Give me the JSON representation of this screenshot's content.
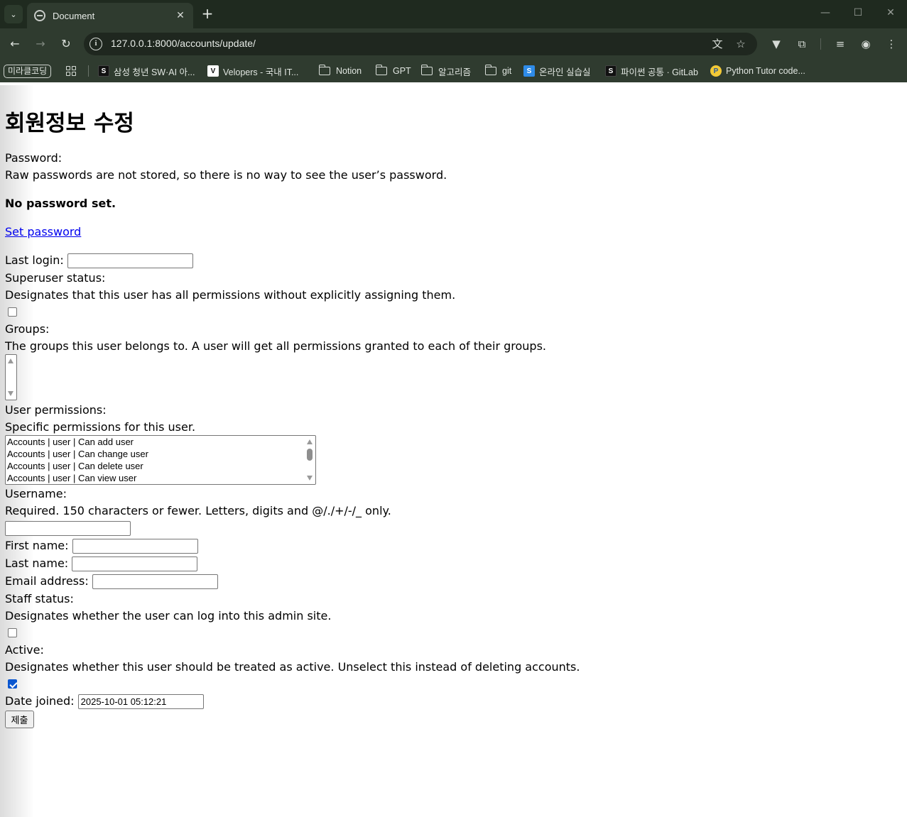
{
  "browser": {
    "tab_title": "Document",
    "url": "127.0.0.1:8000/accounts/update/",
    "bookmarks": [
      {
        "label": "미라클코딩",
        "kind": "pill"
      },
      {
        "label": "",
        "kind": "apps"
      },
      {
        "label": "삼성 청년 SW·AI 아...",
        "kind": "favicon-dark"
      },
      {
        "label": "Velopers - 국내 IT...",
        "kind": "favicon-velog"
      },
      {
        "label": "Notion",
        "kind": "folder"
      },
      {
        "label": "GPT",
        "kind": "folder"
      },
      {
        "label": "알고리즘",
        "kind": "folder"
      },
      {
        "label": "git",
        "kind": "folder"
      },
      {
        "label": "온라인 실습실",
        "kind": "favicon-blue"
      },
      {
        "label": "파이썬 공통 · GitLab",
        "kind": "favicon-dark"
      },
      {
        "label": "Python Tutor code...",
        "kind": "favicon-python"
      }
    ]
  },
  "page": {
    "heading": "회원정보 수정",
    "password": {
      "label": "Password:",
      "help": "Raw passwords are not stored, so there is no way to see the user’s password.",
      "status": "No password set.",
      "link": "Set password"
    },
    "last_login": {
      "label": "Last login:",
      "value": ""
    },
    "superuser": {
      "label": "Superuser status:",
      "help": "Designates that this user has all permissions without explicitly assigning them.",
      "checked": false
    },
    "groups": {
      "label": "Groups:",
      "help": "The groups this user belongs to. A user will get all permissions granted to each of their groups."
    },
    "user_permissions": {
      "label": "User permissions:",
      "help": "Specific permissions for this user.",
      "options": [
        "Accounts | user | Can add user",
        "Accounts | user | Can change user",
        "Accounts | user | Can delete user",
        "Accounts | user | Can view user"
      ]
    },
    "username": {
      "label": "Username:",
      "help": "Required. 150 characters or fewer. Letters, digits and @/./+/-/_ only.",
      "value": ""
    },
    "first_name": {
      "label": "First name:",
      "value": ""
    },
    "last_name": {
      "label": "Last name:",
      "value": ""
    },
    "email": {
      "label": "Email address:",
      "value": ""
    },
    "staff": {
      "label": "Staff status:",
      "help": "Designates whether the user can log into this admin site.",
      "checked": false
    },
    "active": {
      "label": "Active:",
      "help": "Designates whether this user should be treated as active. Unselect this instead of deleting accounts.",
      "checked": true
    },
    "date_joined": {
      "label": "Date joined:",
      "value": "2025-10-01 05:12:21"
    },
    "submit_label": "제출"
  }
}
